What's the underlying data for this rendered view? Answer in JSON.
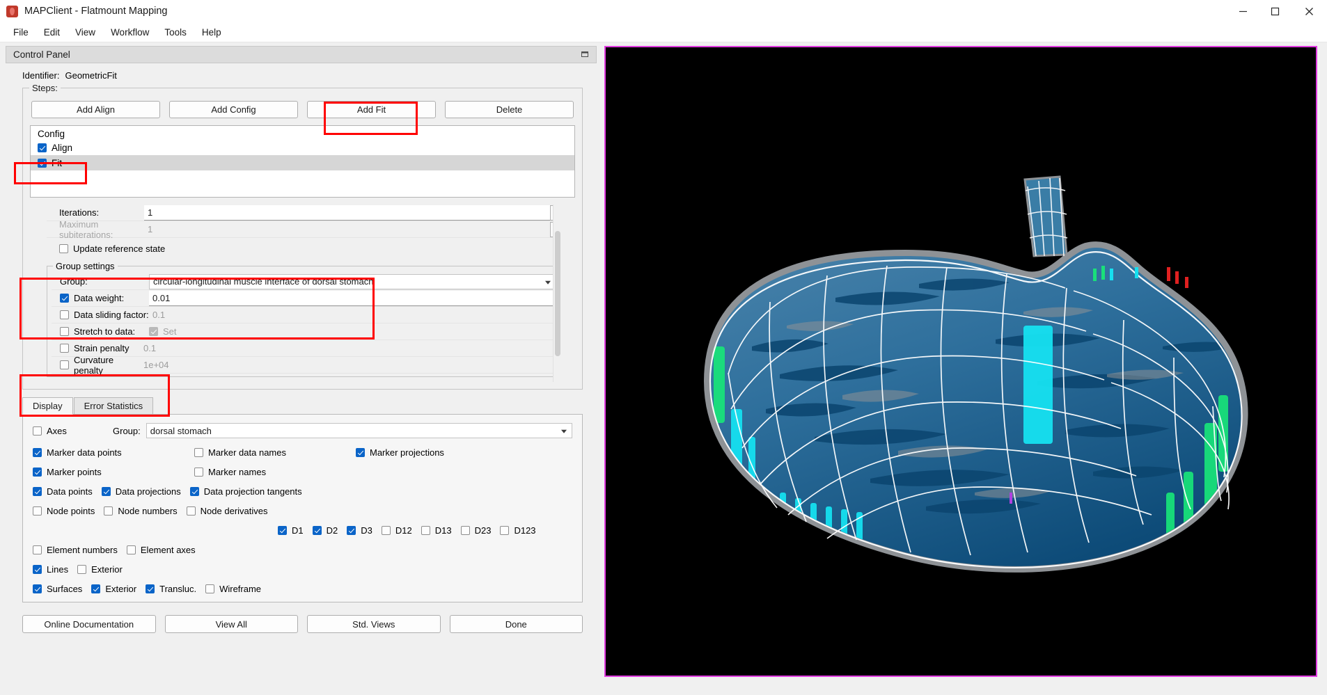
{
  "window": {
    "title": "MAPClient - Flatmount Mapping",
    "app_icon": "mapclient-logo-icon",
    "minimize": "minimize-icon",
    "maximize": "maximize-icon",
    "close": "close-icon"
  },
  "menubar": {
    "items": [
      "File",
      "Edit",
      "View",
      "Workflow",
      "Tools",
      "Help"
    ]
  },
  "control_panel": {
    "title": "Control Panel",
    "float_icon": "undock-icon",
    "identifier_label": "Identifier:",
    "identifier_value": "GeometricFit"
  },
  "steps": {
    "group_title": "Steps:",
    "buttons": [
      "Add Align",
      "Add Config",
      "Add Fit",
      "Delete"
    ],
    "list_header": "Config",
    "items": [
      {
        "label": "Align",
        "checked": true,
        "selected": false
      },
      {
        "label": "Fit",
        "checked": true,
        "selected": true
      }
    ]
  },
  "fit_settings": {
    "iterations_label": "Iterations:",
    "iterations_value": "1",
    "max_subiterations_label": "Maximum subiterations:",
    "max_subiterations_value": "1",
    "update_reference_state_label": "Update reference state",
    "update_reference_state_checked": false
  },
  "group_settings": {
    "title": "Group settings",
    "group_label": "Group:",
    "group_value": "circular-longitudinal muscle interface of dorsal stomach",
    "data_weight_label": "Data weight:",
    "data_weight_checked": true,
    "data_weight_value": "0.01",
    "data_sliding_factor_label": "Data sliding factor:",
    "data_sliding_factor_checked": false,
    "data_sliding_factor_value": "0.1",
    "stretch_to_data_label": "Stretch to data:",
    "stretch_to_data_checked": false,
    "stretch_set_label": "Set",
    "stretch_set_checked": true,
    "strain_penalty_label": "Strain penalty",
    "strain_penalty_checked": false,
    "strain_penalty_value": "0.1",
    "curvature_penalty_label": "Curvature penalty",
    "curvature_penalty_checked": false,
    "curvature_penalty_value": "1e+04"
  },
  "tabs": [
    {
      "label": "Display",
      "active": true
    },
    {
      "label": "Error Statistics",
      "active": false
    }
  ],
  "display": {
    "axes_label": "Axes",
    "axes_checked": false,
    "group_label": "Group:",
    "group_value": "dorsal stomach",
    "row1": [
      {
        "label": "Marker data points",
        "checked": true
      },
      {
        "label": "Marker data names",
        "checked": false
      },
      {
        "label": "Marker projections",
        "checked": true
      }
    ],
    "row2": [
      {
        "label": "Marker points",
        "checked": true
      },
      {
        "label": "Marker names",
        "checked": false
      }
    ],
    "row3": [
      {
        "label": "Data points",
        "checked": true
      },
      {
        "label": "Data projections",
        "checked": true
      },
      {
        "label": "Data projection tangents",
        "checked": true
      }
    ],
    "row4": [
      {
        "label": "Node points",
        "checked": false
      },
      {
        "label": "Node numbers",
        "checked": false
      },
      {
        "label": "Node derivatives",
        "checked": false
      }
    ],
    "derivatives": [
      {
        "label": "D1",
        "checked": true
      },
      {
        "label": "D2",
        "checked": true
      },
      {
        "label": "D3",
        "checked": true
      },
      {
        "label": "D12",
        "checked": false
      },
      {
        "label": "D13",
        "checked": false
      },
      {
        "label": "D23",
        "checked": false
      },
      {
        "label": "D123",
        "checked": false
      }
    ],
    "row5": [
      {
        "label": "Element numbers",
        "checked": false
      },
      {
        "label": "Element axes",
        "checked": false
      }
    ],
    "row6": [
      {
        "label": "Lines",
        "checked": true
      },
      {
        "label": "Exterior",
        "checked": false
      }
    ],
    "row7": [
      {
        "label": "Surfaces",
        "checked": true
      },
      {
        "label": "Exterior",
        "checked": true
      },
      {
        "label": "Transluc.",
        "checked": true
      },
      {
        "label": "Wireframe",
        "checked": false
      }
    ]
  },
  "bottom_buttons": [
    "Online Documentation",
    "View All",
    "Std. Views",
    "Done"
  ],
  "viewport": {
    "border_color": "#e23ae2",
    "background": "#000000",
    "model_description": "3D flatmount stomach mesh with fitted wireframe overlay",
    "colors": {
      "mesh_line": "#ffffff",
      "surface_mid_blue": "#3d7ea6",
      "surface_dark_blue": "#0c4a78",
      "surface_grey": "#8e9296",
      "accent_cyan": "#16e0f0",
      "accent_green": "#19e07a",
      "accent_red": "#e02020"
    }
  },
  "annotations": {
    "color": "#ff0000",
    "boxes": [
      "add-fit-button",
      "fit-step-item",
      "group-and-data-weight",
      "strain-and-curvature-penalty"
    ]
  }
}
